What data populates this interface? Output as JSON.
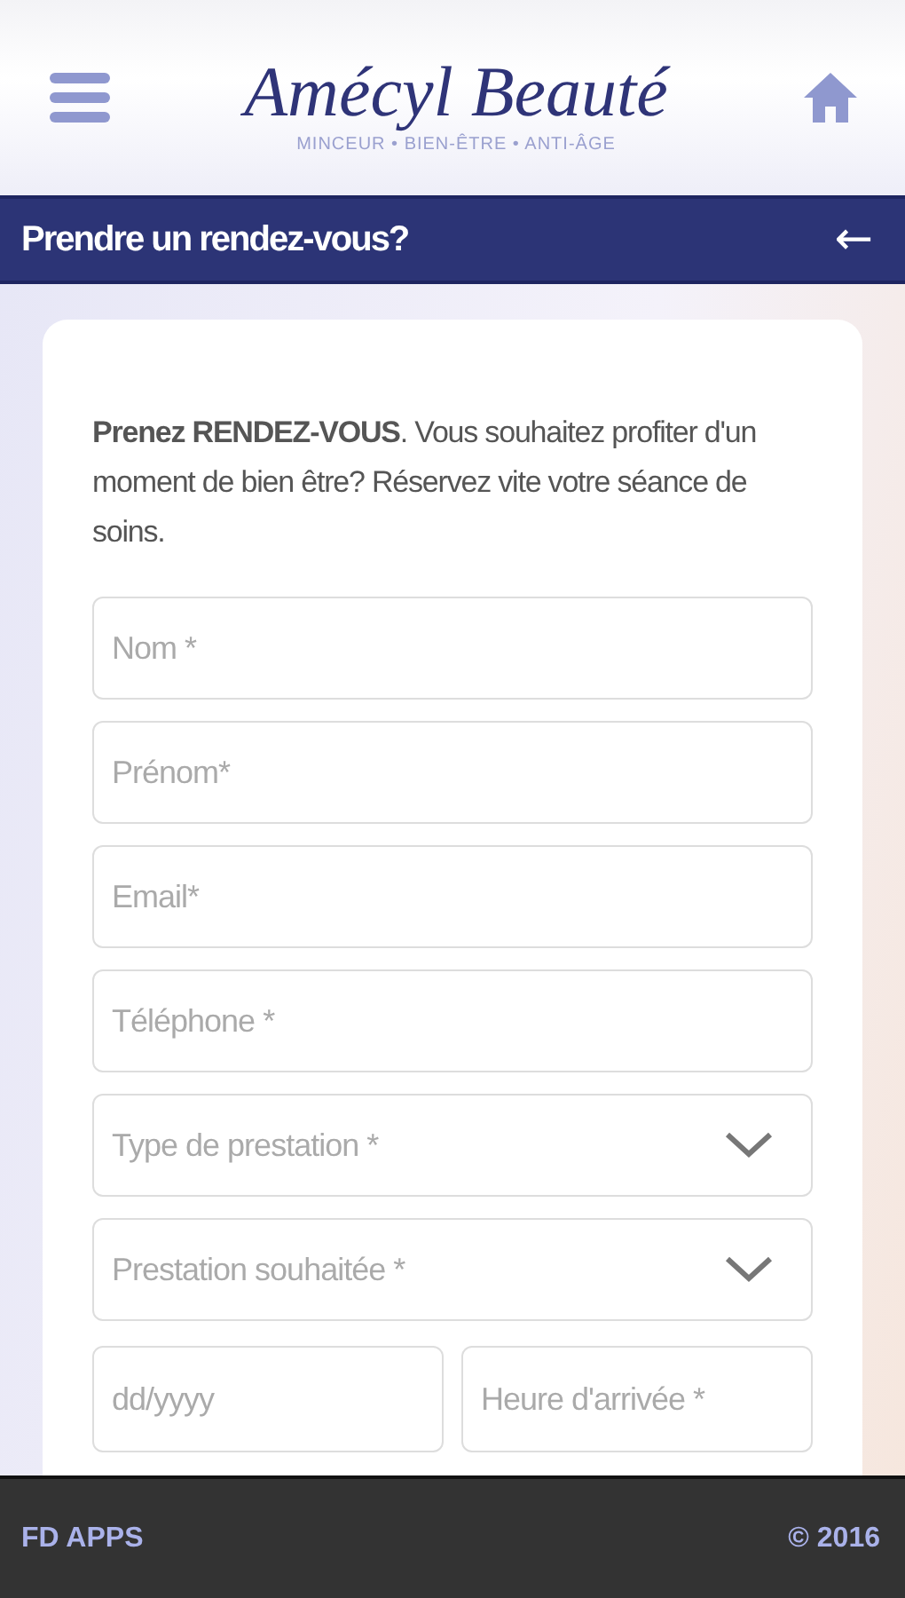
{
  "header": {
    "logo": "Amécyl Beauté",
    "tagline": "MINCEUR • BIEN-ÊTRE • ANTI-ÂGE"
  },
  "title_bar": {
    "title": "Prendre un rendez-vous?",
    "back": "←"
  },
  "intro": "**Prenez RENDEZ-VOUS**. Vous souhaitez profiter d'un moment de bien être? Réservez vite votre séance de soins.",
  "fields": [
    {
      "kind": "text",
      "placeholder": "Nom *"
    },
    {
      "kind": "text",
      "placeholder": "Prénom*"
    },
    {
      "kind": "text",
      "placeholder": "Email*"
    },
    {
      "kind": "text",
      "placeholder": "Téléphone *"
    },
    {
      "kind": "select",
      "placeholder": "Type de prestation *"
    },
    {
      "kind": "select",
      "placeholder": "Prestation souhaitée *"
    }
  ],
  "date_row": [
    {
      "placeholder": "dd/yyyy"
    },
    {
      "placeholder": "Heure d'arrivée *"
    }
  ],
  "footer": {
    "left": "FD APPS",
    "right": "© 2016"
  }
}
